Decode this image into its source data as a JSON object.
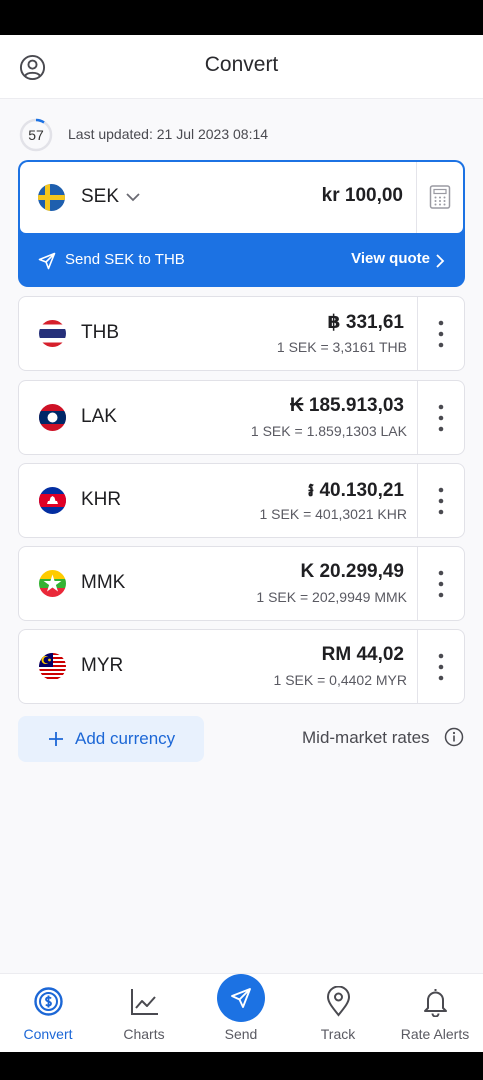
{
  "header": {
    "title": "Convert"
  },
  "status": {
    "timer": "57",
    "last_updated": "Last updated: 21 Jul 2023 08:14"
  },
  "base": {
    "code": "SEK",
    "amount": "kr 100,00",
    "send_label": "Send SEK to THB",
    "quote_label": "View quote"
  },
  "currencies": [
    {
      "code": "THB",
      "amount": "฿ 331,61",
      "rate": "1 SEK = 3,3161 THB"
    },
    {
      "code": "LAK",
      "amount": "₭ 185.913,03",
      "rate": "1 SEK = 1.859,1303 LAK"
    },
    {
      "code": "KHR",
      "amount": "៛ 40.130,21",
      "rate": "1 SEK = 401,3021 KHR"
    },
    {
      "code": "MMK",
      "amount": "K 20.299,49",
      "rate": "1 SEK = 202,9949 MMK"
    },
    {
      "code": "MYR",
      "amount": "RM 44,02",
      "rate": "1 SEK = 0,4402 MYR"
    }
  ],
  "actions": {
    "add_currency": "Add currency",
    "mid_market": "Mid-market rates"
  },
  "nav": [
    {
      "label": "Convert",
      "icon": "convert-icon",
      "active": true
    },
    {
      "label": "Charts",
      "icon": "chart-icon"
    },
    {
      "label": "Send",
      "icon": "send-icon"
    },
    {
      "label": "Track",
      "icon": "location-pin-icon"
    },
    {
      "label": "Rate Alerts",
      "icon": "bell-icon"
    }
  ],
  "colors": {
    "accent": "#1c72e3",
    "accent_text": "#1c67d6",
    "background": "#f9f9fb"
  }
}
